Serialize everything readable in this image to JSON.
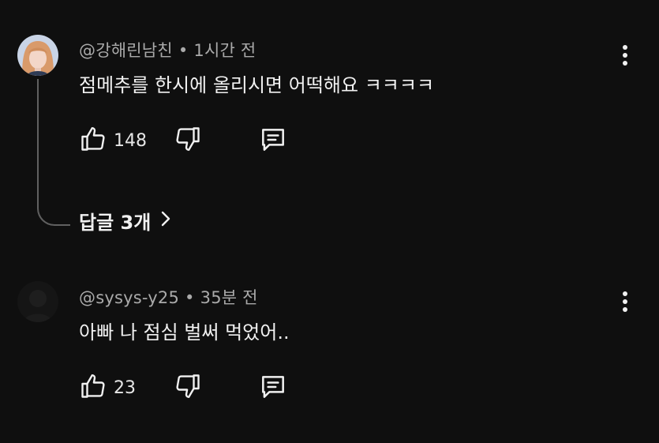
{
  "comments": [
    {
      "author": "@강해린남친",
      "separator": "•",
      "time": "1시간 전",
      "text": "점메추를 한시에 올리시면 어떡해요 ㅋㅋㅋㅋ",
      "likes": "148",
      "replies_label": "답글 3개",
      "colors": {
        "avatar_hair": "#d99a6a",
        "avatar_skin": "#f3d6c8"
      }
    },
    {
      "author": "@sysys-y25",
      "separator": "•",
      "time": "35분 전",
      "text": "아빠 나 점심 벌써 먹었어..",
      "likes": "23",
      "colors": {
        "avatar_bg": "#1a1a1a"
      }
    }
  ],
  "icons": {
    "like": "thumbs-up-icon",
    "dislike": "thumbs-down-icon",
    "reply": "reply-comment-icon",
    "menu": "more-vertical-icon",
    "expand": "chevron-right-icon"
  },
  "theme": {
    "background": "#0f0f0f",
    "text": "#f1f1f1",
    "meta": "#aaaaaa",
    "line": "#606060"
  }
}
